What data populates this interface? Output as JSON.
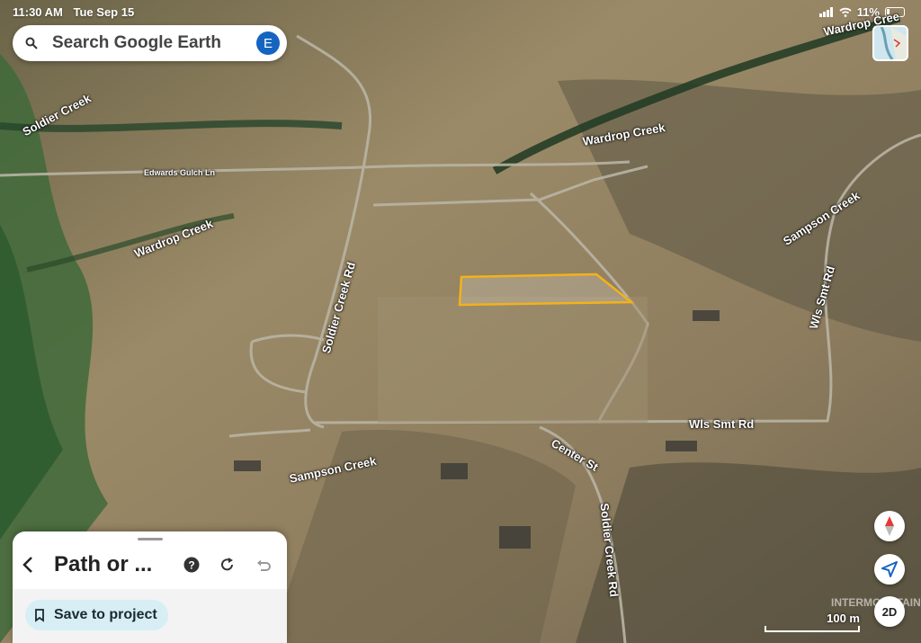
{
  "status": {
    "time": "11:30 AM",
    "date": "Tue Sep 15",
    "battery": "11%"
  },
  "search": {
    "placeholder": "Search Google Earth",
    "avatar_letter": "E"
  },
  "map_labels": [
    "Soldier Creek",
    "Edwards Gulch Ln",
    "Wardrop Creek",
    "Wardrop Creek",
    "Wardrop Cree",
    "Sampson Creek",
    "Soldier Creek Rd",
    "Wls Smt Rd",
    "Wls Smt Rd",
    "Center St",
    "Soldier Creek Rd",
    "Sampson Creek"
  ],
  "scale": "100 m",
  "watermark": "INTERMOUNTAIN",
  "controls": {
    "view_mode": "2D"
  },
  "panel": {
    "title": "Path or ...",
    "save_label": "Save to project"
  },
  "colors": {
    "outline": "#f3b21a",
    "accent": "#1565c0"
  }
}
